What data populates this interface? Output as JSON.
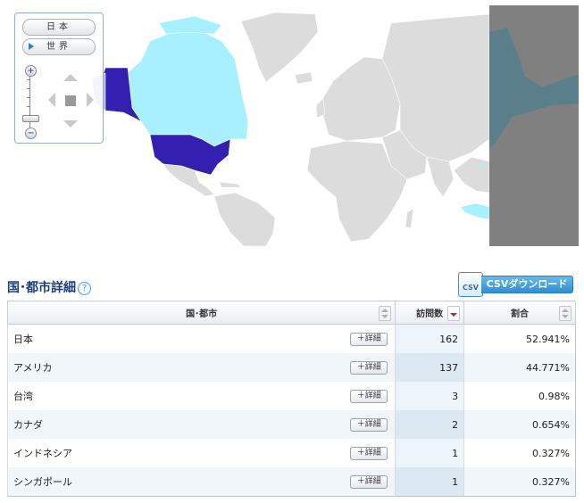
{
  "map": {
    "controls": {
      "japan_label": "日本",
      "world_label": "世界",
      "zoom_in_label": "+",
      "zoom_out_label": "−"
    },
    "colors": {
      "ocean": "#ffffff",
      "land_default": "#dcdcdc",
      "high_visits": "#3320b0",
      "low_visits": "#a8f0ff",
      "mid_visits": "#b3b3e6",
      "map_edge": "#808080"
    }
  },
  "section": {
    "title": "国･都市詳細",
    "help_icon": "?",
    "csv_icon_text": "CSV",
    "csv_button_label": "CSVダウンロード"
  },
  "table": {
    "headers": {
      "name": "国･都市",
      "visits": "訪問数",
      "ratio": "割合"
    },
    "detail_label": "＋詳細",
    "rows": [
      {
        "name": "日本",
        "visits": "162",
        "ratio": "52.941%"
      },
      {
        "name": "アメリカ",
        "visits": "137",
        "ratio": "44.771%"
      },
      {
        "name": "台湾",
        "visits": "3",
        "ratio": "0.98%"
      },
      {
        "name": "カナダ",
        "visits": "2",
        "ratio": "0.654%"
      },
      {
        "name": "インドネシア",
        "visits": "1",
        "ratio": "0.327%"
      },
      {
        "name": "シンガポール",
        "visits": "1",
        "ratio": "0.327%"
      }
    ]
  }
}
